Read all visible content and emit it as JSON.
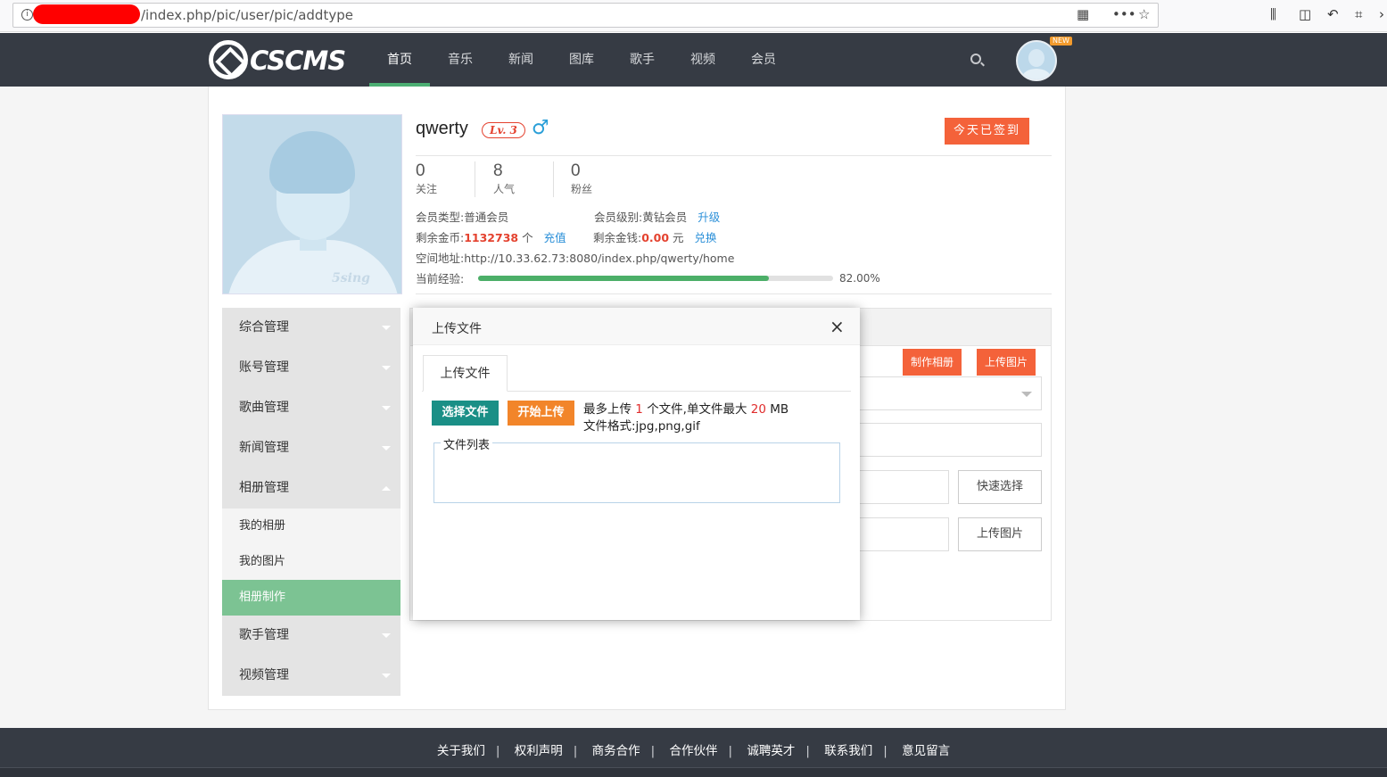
{
  "browser": {
    "url": "/index.php/pic/user/pic/addtype",
    "info_icon": "info-icon"
  },
  "header": {
    "logo_text": "CSCMS",
    "nav": [
      "首页",
      "音乐",
      "新闻",
      "图库",
      "歌手",
      "视频",
      "会员"
    ],
    "active_nav": "首页",
    "new_badge": "NEW"
  },
  "profile": {
    "username": "qwerty",
    "level": "Lv. 3",
    "gender_symbol": "♂",
    "checkin_label": "今天已签到",
    "stats": [
      {
        "num": "0",
        "label": "关注"
      },
      {
        "num": "8",
        "label": "人气"
      },
      {
        "num": "0",
        "label": "粉丝"
      }
    ],
    "member_type_label": "会员类型:",
    "member_type": "普通会员",
    "member_level_label": "会员级别:",
    "member_level": "黄钻会员",
    "upgrade_link": "升级",
    "coins_label": "剩余金币:",
    "coins": "1132738",
    "coins_unit": "个",
    "recharge_link": "充值",
    "money_label": "剩余金钱:",
    "money": "0.00",
    "money_unit": "元",
    "exchange_link": "兑换",
    "space_label": "空间地址:",
    "space_url": "http://10.33.62.73:8080/index.php/qwerty/home",
    "exp_label": "当前经验:",
    "exp_percent_text": "82.00%",
    "exp_fraction": 0.82,
    "avatar_watermark": "5sing"
  },
  "sidebar": {
    "groups": [
      "综合管理",
      "账号管理",
      "歌曲管理",
      "新闻管理",
      "相册管理"
    ],
    "sub_items": [
      "我的相册",
      "我的图片",
      "相册制作"
    ],
    "active_sub": "相册制作",
    "groups_after": [
      "歌手管理",
      "视频管理"
    ]
  },
  "content": {
    "make_album_btn": "制作相册",
    "upload_pic_btn": "上传图片",
    "quick_select_btn": "快速选择",
    "upload_pic_btn2": "上传图片"
  },
  "modal": {
    "title": "上传文件",
    "close": "×",
    "tab": "上传文件",
    "choose_btn": "选择文件",
    "start_btn": "开始上传",
    "tip_prefix": "最多上传",
    "max_files": "1",
    "tip_mid": "个文件,单文件最大",
    "max_size": "20",
    "tip_unit": "MB",
    "formats": "文件格式:jpg,png,gif",
    "file_list_legend": "文件列表"
  },
  "footer": {
    "links": [
      "关于我们",
      "权利声明",
      "商务合作",
      "合作伙伴",
      "诚聘英才",
      "联系我们",
      "意见留言"
    ]
  },
  "colors": {
    "header_bg": "#363b44",
    "accent_green": "#4caf73",
    "accent_orange": "#f4623a",
    "teal": "#1a8f86"
  }
}
